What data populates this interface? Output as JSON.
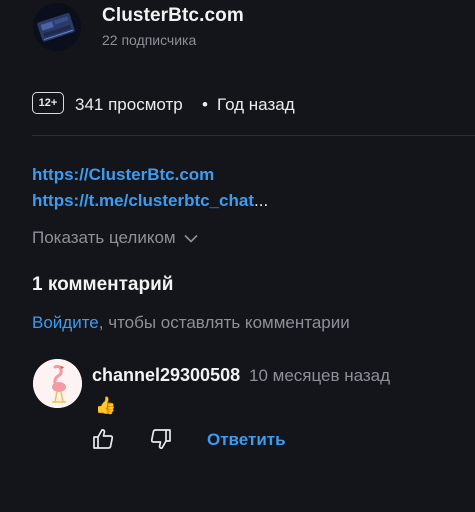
{
  "channel": {
    "name": "ClusterBtc.com",
    "subscribers": "22 подписчика",
    "avatar_icon": "channel-logo-icon"
  },
  "video_meta": {
    "age_rating": "12+",
    "views": "341 просмотр",
    "separator": "•",
    "posted": "Год назад"
  },
  "description": {
    "link1": "https://ClusterBtc.com",
    "link2": "https://t.me/clusterbtc_chat",
    "link2_ellipsis": "...",
    "expand_label": "Показать целиком"
  },
  "comments": {
    "title": "1 комментарий",
    "login_link": "Войдите",
    "login_rest": ", чтобы оставлять комментарии",
    "items": [
      {
        "author": "channel29300508",
        "time": "10 месяцев назад",
        "text": "👍",
        "reply_label": "Ответить",
        "avatar_icon": "flamingo-avatar-icon"
      }
    ]
  },
  "colors": {
    "background": "#14151a",
    "link": "#3d9cf0",
    "muted": "#8d9099"
  }
}
